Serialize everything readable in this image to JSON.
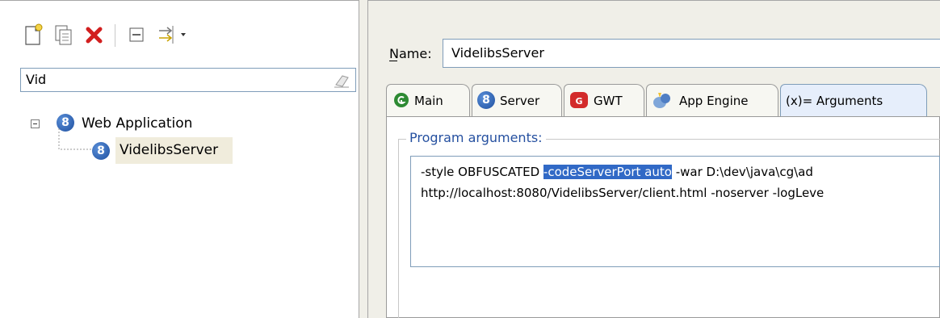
{
  "left": {
    "filter": {
      "value": "Vid"
    },
    "tree": {
      "parent_label": "Web Application",
      "child_label": "VidelibsServer"
    }
  },
  "right": {
    "name_label": "Name:",
    "name_value": "VidelibsServer",
    "tabs": [
      {
        "label": "Main",
        "icon": "main-icon"
      },
      {
        "label": "Server",
        "icon": "server-icon"
      },
      {
        "label": "GWT",
        "icon": "gwt-icon"
      },
      {
        "label": "App Engine",
        "icon": "app-engine-icon"
      },
      {
        "label": "(x)= Arguments",
        "icon": "arguments-icon",
        "selected": true
      }
    ],
    "program_args_label": "Program arguments:",
    "args": {
      "line1_pre": "-style OBFUSCATED ",
      "line1_hl": "-codeServerPort auto",
      "line1_post": " -war D:\\dev\\java\\cg\\ad",
      "line2": "http://localhost:8080/VidelibsServer/client.html -noserver -logLeve"
    }
  },
  "colors": {
    "selection": "#3169c6",
    "legend": "#2550a0",
    "tree_selected_bg": "#f0ecdc"
  }
}
